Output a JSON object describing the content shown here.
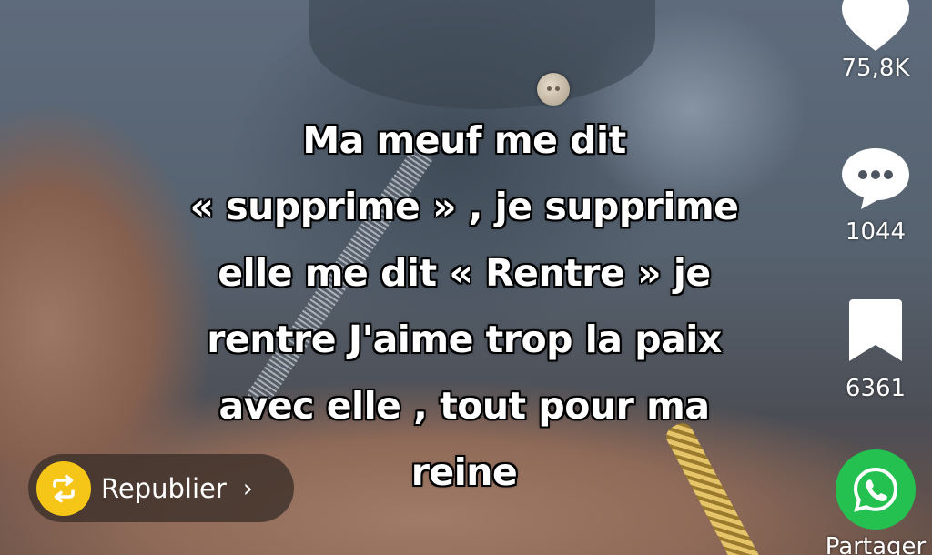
{
  "video": {
    "caption_lines": [
      "Ma meuf me dit",
      "« supprime » , je supprime",
      "elle me dit « Rentre » je",
      "rentre J'aime trop la paix",
      "avec elle , tout pour ma",
      "reine"
    ]
  },
  "actions": {
    "like": {
      "icon": "heart-icon",
      "count": "75,8K"
    },
    "comment": {
      "icon": "comment-bubble-icon",
      "count": "1044"
    },
    "bookmark": {
      "icon": "bookmark-icon",
      "count": "6361"
    },
    "share": {
      "icon": "whatsapp-icon",
      "label": "Partager",
      "color": "#25C150"
    }
  },
  "republish": {
    "icon": "repost-icon",
    "label": "Republier",
    "chevron": "›",
    "icon_color": "#F5C518"
  }
}
